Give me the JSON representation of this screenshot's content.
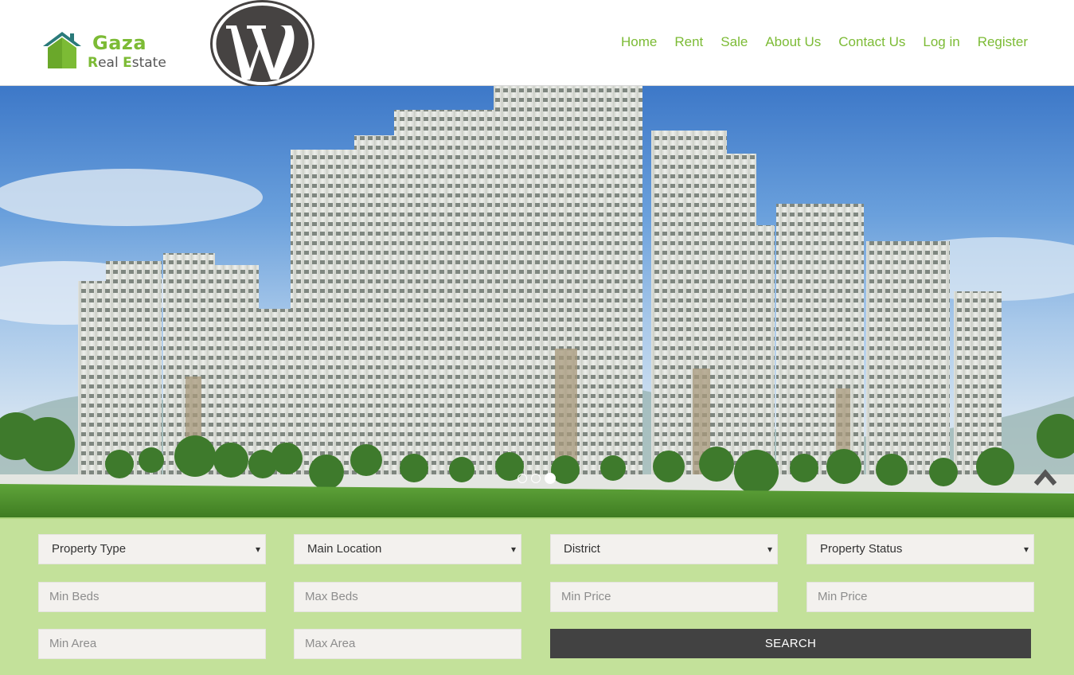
{
  "header": {
    "logo_line1": "Gaza",
    "logo_line2_r": "R",
    "logo_line2_eal": "eal ",
    "logo_line2_e": "E",
    "logo_line2_state": "state",
    "nav": [
      "Home",
      "Rent",
      "Sale",
      "About Us",
      "Contact Us",
      "Log in",
      "Register"
    ]
  },
  "hero": {
    "slide_count": 3,
    "active_slide": 3
  },
  "search": {
    "property_type": "Property Type",
    "main_location": "Main Location",
    "district": "District",
    "property_status": "Property Status",
    "min_beds": "Min Beds",
    "max_beds": "Max Beds",
    "min_price": "Min Price",
    "min_price_2": "Min Price",
    "min_area": "Min Area",
    "max_area": "Max Area",
    "button": "SEARCH"
  },
  "colors": {
    "brand_green": "#7cbb35",
    "search_bg": "#c3e19a",
    "button_bg": "#424242"
  }
}
